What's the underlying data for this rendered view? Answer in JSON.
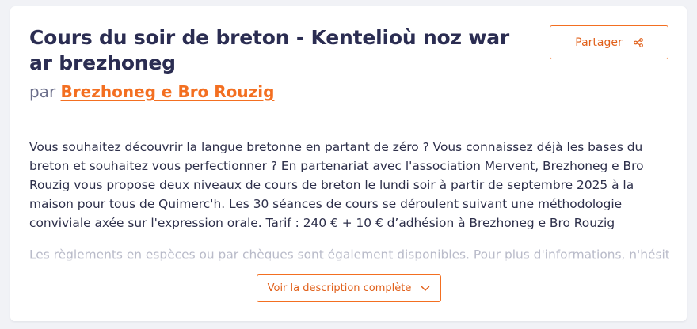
{
  "event": {
    "title": "Cours du soir de breton - Kentelioù noz war ar brezhoneg",
    "by_prefix": "par",
    "organizer": "Brezhoneg e Bro Rouzig"
  },
  "actions": {
    "share_label": "Partager",
    "share_icon": "share-icon",
    "expand_label": "Voir la description complète",
    "expand_icon": "chevron-down-icon"
  },
  "description": {
    "paragraph_1": "Vous souhaitez découvrir la langue bretonne en partant de zéro ? Vous connaissez déjà les bases du breton et souhaitez vous perfectionner ? En partenariat avec l'association Mervent, Brezhoneg e Bro Rouzig vous propose deux niveaux de cours de breton le lundi soir à partir de septembre 2025 à la maison pour tous de Quimerc'h. Les 30 séances de cours se déroulent suivant une méthodologie conviviale axée sur l'expression orale. Tarif : 240 € + 10 € d’adhésion à Brezhoneg e Bro Rouzig",
    "paragraph_2": "Les règlements en espèces ou par chèques sont également disponibles. Pour plus d'informations, n'hésitez"
  },
  "colors": {
    "accent": "#f36f21",
    "title": "#2b2d52",
    "muted": "#6b6e8a"
  }
}
